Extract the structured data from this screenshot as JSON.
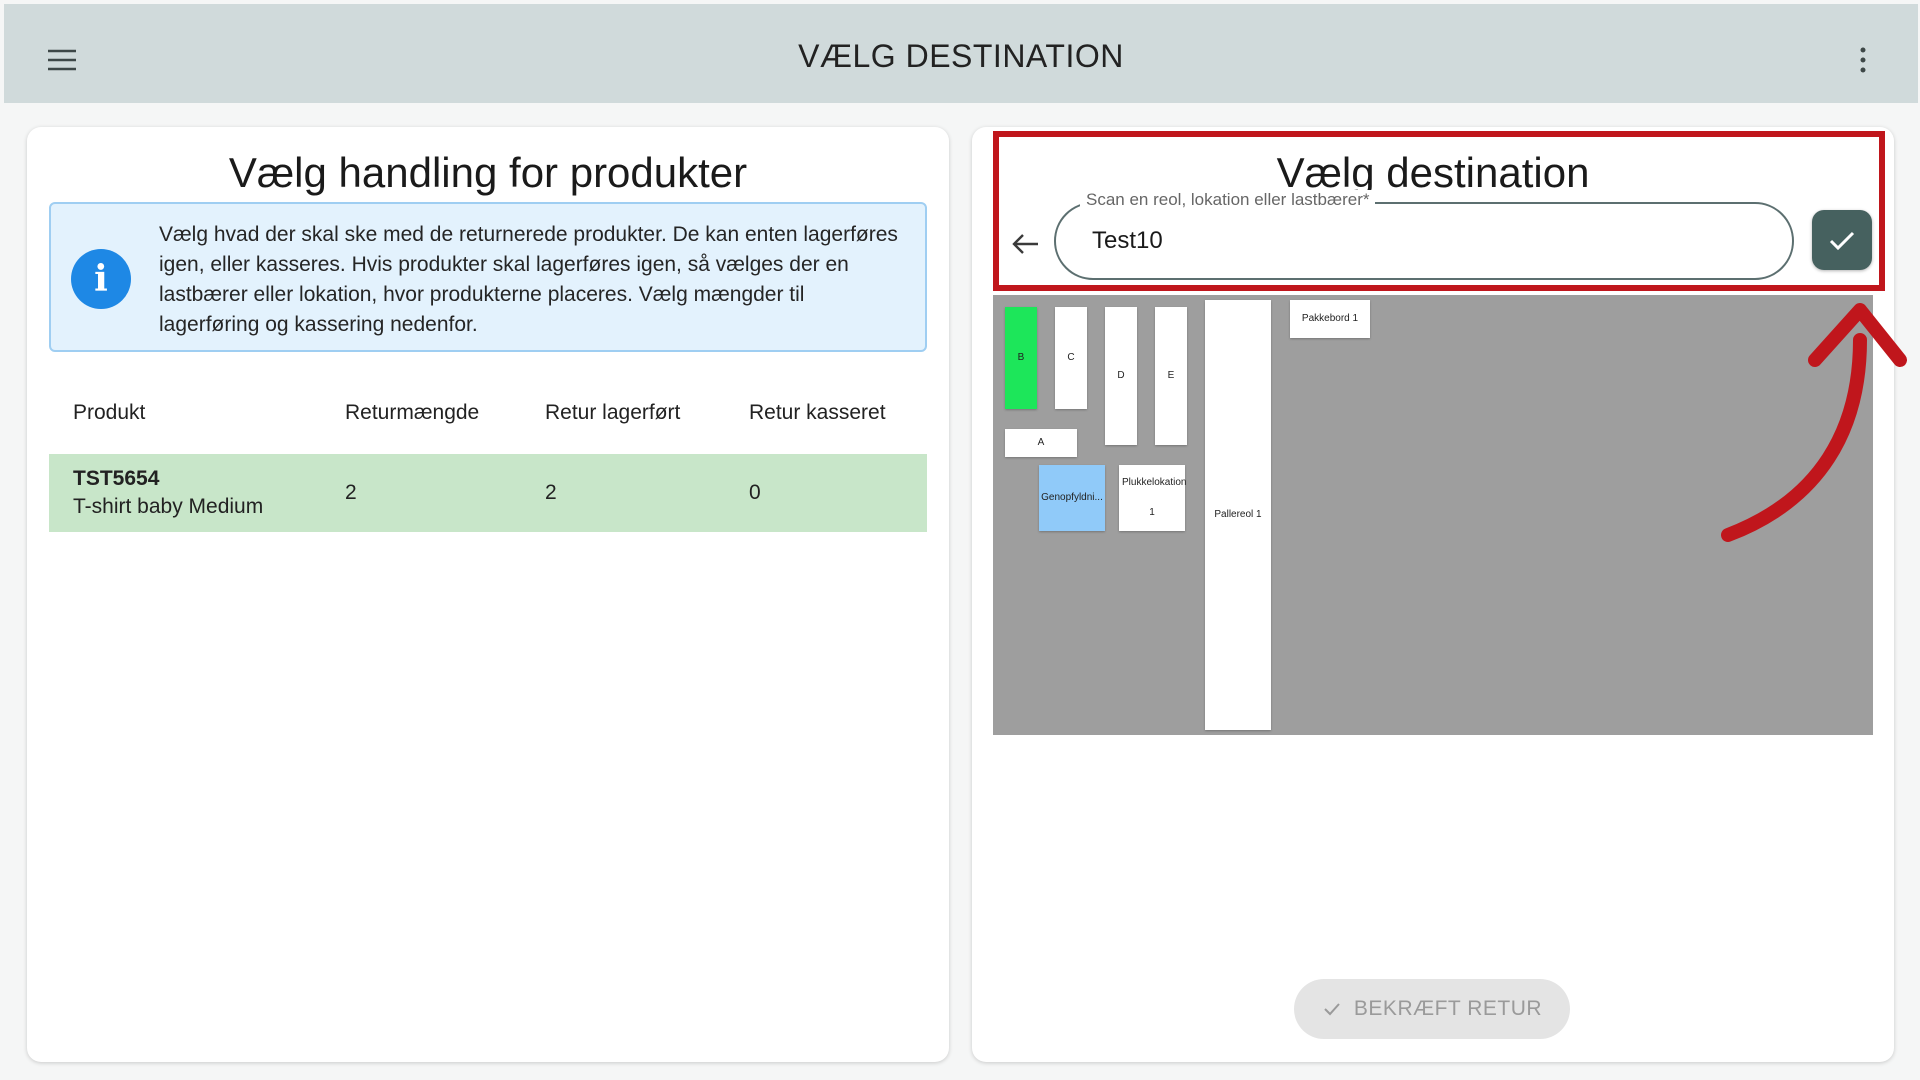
{
  "appbar": {
    "title": "VÆLG DESTINATION",
    "menu_icon": "hamburger-menu-icon",
    "more_icon": "more-vertical-icon"
  },
  "left": {
    "heading": "Vælg handling for produkter",
    "info_icon": "info-icon",
    "info_text": "Vælg hvad der skal ske med de returnerede produkter. De kan enten lagerføres igen, eller kasseres. Hvis produkter skal lagerføres igen, så vælges der en lastbærer eller lokation, hvor produkterne placeres. Vælg mængder til lagerføring og kassering nedenfor.",
    "table": {
      "headers": [
        "Produkt",
        "Returmængde",
        "Retur lagerført",
        "Retur kasseret"
      ],
      "rows": [
        {
          "code": "TST5654",
          "name": "T-shirt baby Medium",
          "return_qty": "2",
          "stocked": "2",
          "discarded": "0"
        }
      ]
    }
  },
  "right": {
    "heading": "Vælg destination",
    "scan_label": "Scan en reol, lokation eller lastbærer*",
    "scan_value": "Test10",
    "back_icon": "arrow-left-icon",
    "confirm_icon": "check-icon",
    "map": {
      "locations": [
        {
          "label": "B",
          "color": "#1de65a"
        },
        {
          "label": "C",
          "color": "#ffffff"
        },
        {
          "label": "D",
          "color": "#ffffff"
        },
        {
          "label": "E",
          "color": "#ffffff"
        },
        {
          "label": "A",
          "color": "#ffffff"
        },
        {
          "label": "Genopfyldni...",
          "color": "#90caf9"
        },
        {
          "label": "Plukkelokation 1",
          "color": "#ffffff"
        },
        {
          "label": "Pallereol 1",
          "color": "#ffffff"
        },
        {
          "label": "Pakkebord 1",
          "color": "#ffffff"
        }
      ]
    },
    "confirm_return_label": "BEKRÆFT RETUR",
    "highlight_color": "#c0161c"
  }
}
